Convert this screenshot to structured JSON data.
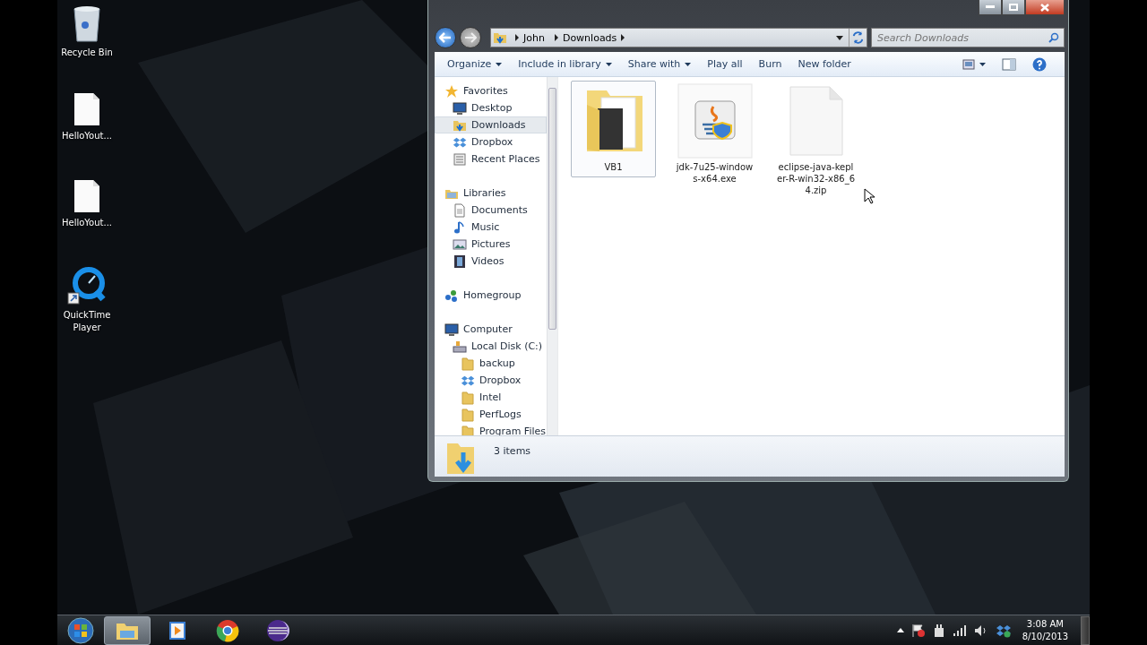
{
  "desktop_icons": [
    {
      "label": "Recycle Bin",
      "kind": "recycle"
    },
    {
      "label": "HelloYout...",
      "kind": "file"
    },
    {
      "label": "HelloYout...",
      "kind": "file"
    },
    {
      "label": "QuickTime Player",
      "kind": "quicktime"
    }
  ],
  "window": {
    "address": [
      "John",
      "Downloads"
    ],
    "search_placeholder": "Search Downloads",
    "toolbar": [
      {
        "label": "Organize",
        "dropdown": true
      },
      {
        "label": "Include in library",
        "dropdown": true
      },
      {
        "label": "Share with",
        "dropdown": true
      },
      {
        "label": "Play all",
        "dropdown": false
      },
      {
        "label": "Burn",
        "dropdown": false
      },
      {
        "label": "New folder",
        "dropdown": false
      }
    ],
    "nav": [
      {
        "label": "Favorites",
        "kind": "star",
        "selected": false,
        "children": [
          {
            "label": "Desktop",
            "kind": "desktop",
            "selected": false
          },
          {
            "label": "Downloads",
            "kind": "downloads",
            "selected": true
          },
          {
            "label": "Dropbox",
            "kind": "dropbox",
            "selected": false
          },
          {
            "label": "Recent Places",
            "kind": "recent",
            "selected": false
          }
        ]
      },
      {
        "label": "Libraries",
        "kind": "library",
        "selected": false,
        "children": [
          {
            "label": "Documents",
            "kind": "document",
            "selected": false
          },
          {
            "label": "Music",
            "kind": "music",
            "selected": false
          },
          {
            "label": "Pictures",
            "kind": "pictures",
            "selected": false
          },
          {
            "label": "Videos",
            "kind": "videos",
            "selected": false
          }
        ]
      },
      {
        "label": "Homegroup",
        "kind": "homegroup",
        "selected": false
      },
      {
        "label": "Computer",
        "kind": "computer",
        "selected": false,
        "children": [
          {
            "label": "Local Disk (C:)",
            "kind": "disk",
            "selected": false,
            "children": [
              {
                "label": "backup",
                "kind": "folder",
                "selected": false
              },
              {
                "label": "Dropbox",
                "kind": "dropbox",
                "selected": false
              },
              {
                "label": "Intel",
                "kind": "folder",
                "selected": false
              },
              {
                "label": "PerfLogs",
                "kind": "folder",
                "selected": false
              },
              {
                "label": "Program Files",
                "kind": "folder",
                "selected": false
              }
            ]
          }
        ]
      }
    ],
    "files": [
      {
        "name": "VB1",
        "kind": "folder",
        "selected": true
      },
      {
        "name": "jdk-7u25-windows-x64.exe",
        "kind": "installer",
        "selected": false
      },
      {
        "name": "eclipse-java-kepler-R-win32-x86_64.zip",
        "kind": "file",
        "selected": false
      }
    ],
    "status": "3 items"
  },
  "taskbar": {
    "apps": [
      {
        "kind": "explorer",
        "selected": true
      },
      {
        "kind": "media",
        "selected": false
      },
      {
        "kind": "chrome",
        "selected": false
      },
      {
        "kind": "eclipse",
        "selected": false
      }
    ],
    "time": "3:08 AM",
    "date": "8/10/2013"
  }
}
